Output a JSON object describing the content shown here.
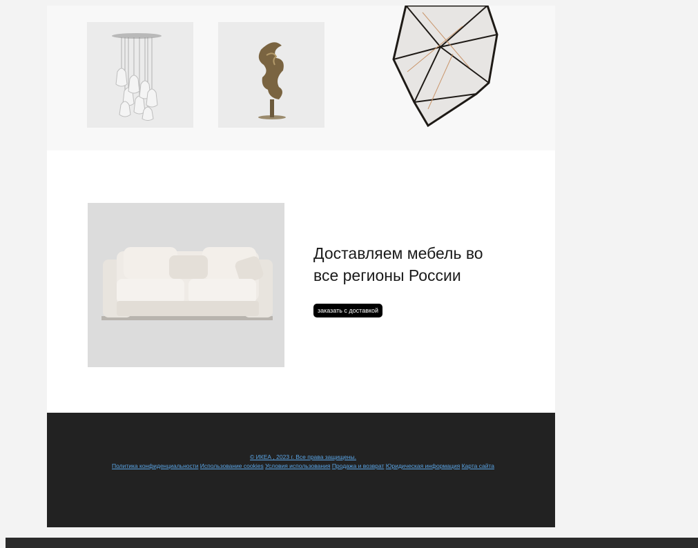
{
  "delivery": {
    "title_line1": "Доставляем мебель во",
    "title_line2": "все регионы России",
    "button_label": "заказать с доставкой"
  },
  "footer": {
    "copyright": "© ИКЕА , 2023 г. Все права защищены.",
    "links": [
      "Политика конфиденциальности",
      "Использование cookies",
      "Условия использования",
      "Продажа и возврат",
      "Юридическая информация",
      "Карта сайта"
    ]
  },
  "colors": {
    "footer_bg": "#222222",
    "link": "#5aa5e6",
    "button_bg": "#000000"
  }
}
